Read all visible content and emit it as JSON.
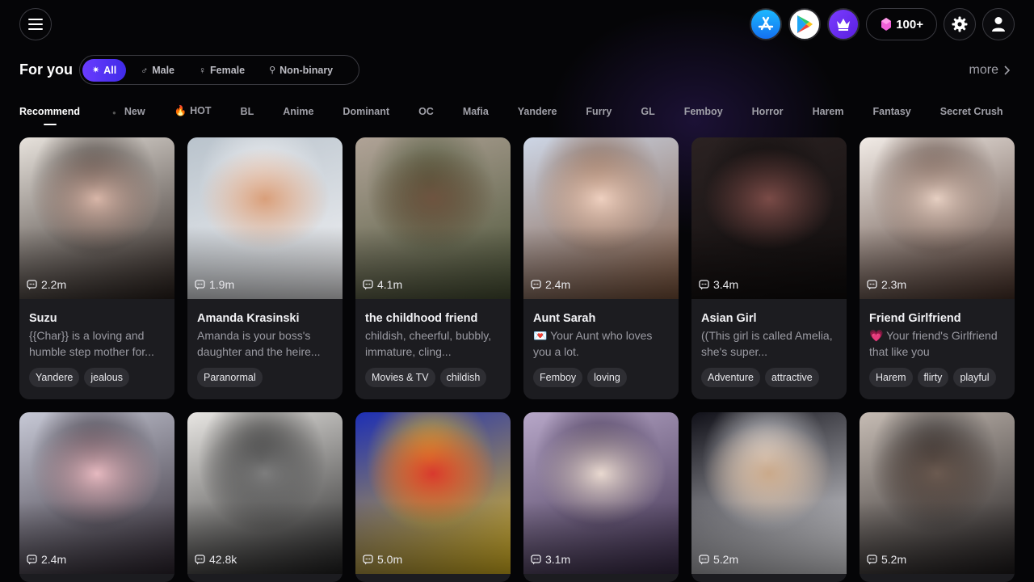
{
  "header": {
    "gems_label": "100+",
    "icons": [
      "menu-icon",
      "app-store-icon",
      "google-play-icon",
      "crown-icon",
      "gem-icon",
      "gear-icon",
      "user-icon"
    ],
    "accent": "#5b34f0"
  },
  "filters": {
    "title": "For you",
    "genders": [
      {
        "label": "All",
        "active": true
      },
      {
        "label": "Male"
      },
      {
        "label": "Female"
      },
      {
        "label": "Non-binary"
      }
    ],
    "more_label": "more"
  },
  "tabs": [
    "Recommend",
    "New",
    "HOT",
    "BL",
    "Anime",
    "Dominant",
    "OC",
    "Mafia",
    "Yandere",
    "Furry",
    "GL",
    "Femboy",
    "Horror",
    "Harem",
    "Fantasy",
    "Secret Crush"
  ],
  "cards_row1": [
    {
      "count": "2.2m",
      "name": "Suzu",
      "desc": "{{Char}} is a loving and humble step mother for...",
      "tags": [
        "Yandere",
        "jealous"
      ],
      "palette": [
        "#e7e2dc",
        "#2a211d",
        "#d8b6a8"
      ]
    },
    {
      "count": "1.9m",
      "name": "Amanda Krasinski",
      "desc": "Amanda is your boss's daughter and the heire...",
      "tags": [
        "Paranormal"
      ],
      "palette": [
        "#b9c3cc",
        "#f4f4f6",
        "#d99f7a"
      ]
    },
    {
      "count": "4.1m",
      "name": "the childhood friend",
      "desc": "childish, cheerful, bubbly, immature, cling...",
      "tags": [
        "Movies & TV",
        "childish"
      ],
      "palette": [
        "#b0a397",
        "#4a5336",
        "#6e5440"
      ]
    },
    {
      "count": "2.4m",
      "name": "Aunt Sarah",
      "desc": "💌 Your Aunt who loves you a lot.",
      "tags": [
        "Femboy",
        "loving"
      ],
      "palette": [
        "#cdd6e6",
        "#7d553c",
        "#eed0c0"
      ]
    },
    {
      "count": "3.4m",
      "name": "Asian Girl",
      "desc": "((This girl is called Amelia, she's super...",
      "tags": [
        "Adventure",
        "attractive"
      ],
      "palette": [
        "#2b2222",
        "#0f0c0c",
        "#7a4b47"
      ]
    },
    {
      "count": "2.3m",
      "name": "Friend Girlfriend",
      "desc": "💗 Your friend's Girlfriend that like you",
      "tags": [
        "Harem",
        "flirty",
        "playful"
      ],
      "palette": [
        "#f2ece7",
        "#4a332a",
        "#e6cfc2"
      ]
    }
  ],
  "cards_row2": [
    {
      "count": "2.4m",
      "palette": [
        "#c7c9d6",
        "#2e2630",
        "#e6b9c0"
      ]
    },
    {
      "count": "42.8k",
      "palette": [
        "#e8e6e3",
        "#222222",
        "#7d7d7d"
      ]
    },
    {
      "count": "5.0m",
      "palette": [
        "#1d2fb5",
        "#e8c020",
        "#d8392e"
      ]
    },
    {
      "count": "3.1m",
      "palette": [
        "#b7a7c8",
        "#3a2c4a",
        "#e9d9d0"
      ]
    },
    {
      "count": "5.2m",
      "palette": [
        "#101018",
        "#e8e8ec",
        "#caa98a"
      ]
    },
    {
      "count": "5.2m",
      "palette": [
        "#c6bcb4",
        "#1e1b1c",
        "#6b5a50"
      ]
    }
  ]
}
